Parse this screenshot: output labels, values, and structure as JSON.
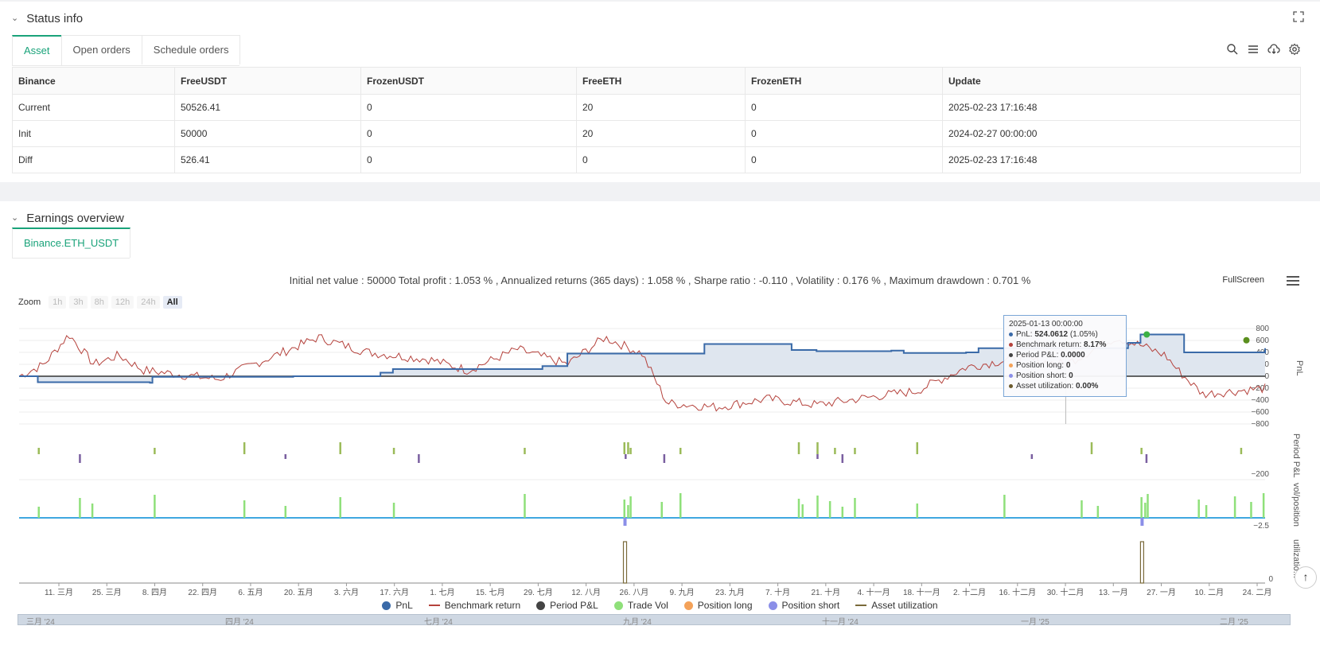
{
  "status": {
    "title": "Status info",
    "tabs": [
      "Asset",
      "Open orders",
      "Schedule orders"
    ],
    "active_tab": "Asset",
    "columns": [
      "Binance",
      "FreeUSDT",
      "FrozenUSDT",
      "FreeETH",
      "FrozenETH",
      "Update"
    ],
    "rows": [
      {
        "label": "Current",
        "cells": [
          "50526.41",
          "0",
          "20",
          "0",
          "2025-02-23 17:16:48"
        ]
      },
      {
        "label": "Init",
        "cells": [
          "50000",
          "0",
          "20",
          "0",
          "2024-02-27 00:00:00"
        ]
      },
      {
        "label": "Diff",
        "cells": [
          "526.41",
          "0",
          "0",
          "0",
          "2025-02-23 17:16:48"
        ]
      }
    ]
  },
  "earnings": {
    "title": "Earnings overview",
    "tab": "Binance.ETH_USDT",
    "summary": "Initial net value : 50000 Total profit : 1.053 % , Annualized returns (365 days) : 1.058 % , Sharpe ratio : -0.110 , Volatility : 0.176 % , Maximum drawdown : 0.701 %",
    "fullscreen_label": "FullScreen",
    "zoom_label": "Zoom",
    "zoom_buttons": [
      "1h",
      "3h",
      "8h",
      "12h",
      "24h",
      "All"
    ],
    "zoom_active": "All"
  },
  "tooltip": {
    "date": "2025-01-13 00:00:00",
    "rows": [
      {
        "label": "PnL: ",
        "value": "524.0612",
        "extra": " (1.05%)",
        "color": "#3a6aa8"
      },
      {
        "label": "Benchmark return: ",
        "value": "8.17%",
        "extra": "",
        "color": "#b5423c"
      },
      {
        "label": "Period P&L: ",
        "value": "0.0000",
        "extra": "",
        "color": "#444444"
      },
      {
        "label": "Position long: ",
        "value": "0",
        "extra": "",
        "color": "#f4a259"
      },
      {
        "label": "Position short: ",
        "value": "0",
        "extra": "",
        "color": "#8b8fe8"
      },
      {
        "label": "Asset utilization: ",
        "value": "0.00%",
        "extra": "",
        "color": "#6b5a2e"
      }
    ]
  },
  "legend": [
    {
      "label": "PnL",
      "color": "#3a6aa8",
      "kind": "dot"
    },
    {
      "label": "Benchmark return",
      "color": "#b5423c",
      "kind": "line"
    },
    {
      "label": "Period P&L",
      "color": "#444444",
      "kind": "dot"
    },
    {
      "label": "Trade Vol",
      "color": "#8fe07a",
      "kind": "dot"
    },
    {
      "label": "Position long",
      "color": "#f4a259",
      "kind": "dot"
    },
    {
      "label": "Position short",
      "color": "#8b8fe8",
      "kind": "dot"
    },
    {
      "label": "Asset utilization",
      "color": "#7a6a3a",
      "kind": "line"
    }
  ],
  "scroller_labels": [
    "三月 '24",
    "四月 '24",
    "七月 '24",
    "九月 '24",
    "十一月 '24",
    "一月 '25",
    "二月 '25"
  ],
  "chart_data": {
    "type": "line",
    "x_ticks": [
      "11. 三月",
      "25. 三月",
      "8. 四月",
      "22. 四月",
      "6. 五月",
      "20. 五月",
      "3. 六月",
      "17. 六月",
      "1. 七月",
      "15. 七月",
      "29. 七月",
      "12. 八月",
      "26. 八月",
      "9. 九月",
      "23. 九月",
      "7. 十月",
      "21. 十月",
      "4. 十一月",
      "18. 十一月",
      "2. 十二月",
      "16. 十二月",
      "30. 十二月",
      "13. 一月",
      "27. 一月",
      "10. 二月",
      "24. 二月"
    ],
    "panes": [
      {
        "name": "PnL",
        "ylabel": "PnL",
        "y_ticks": [
          "800",
          "600",
          "400",
          "200",
          "0",
          "−200",
          "−400",
          "−600",
          "−800"
        ]
      },
      {
        "name": "Period P&L",
        "ylabel": "Period P&L",
        "y_ticks": [
          "−200"
        ]
      },
      {
        "name": "vol/position",
        "ylabel": "vol/position",
        "y_ticks": [
          "−2.5"
        ]
      },
      {
        "name": "utilization",
        "ylabel": "utilizatio...",
        "y_ticks": [
          "0"
        ]
      }
    ],
    "pnl": {
      "x": [
        0,
        0.015,
        0.105,
        0.107,
        0.22,
        0.29,
        0.3,
        0.42,
        0.44,
        0.49,
        0.5,
        0.54,
        0.55,
        0.6,
        0.62,
        0.64,
        0.7,
        0.71,
        0.76,
        0.77,
        0.8,
        0.88,
        0.89,
        0.9,
        0.905,
        0.925,
        0.935,
        0.96,
        1.0
      ],
      "y": [
        0,
        -100,
        -110,
        -10,
        0,
        60,
        120,
        170,
        380,
        380,
        380,
        380,
        540,
        540,
        440,
        420,
        430,
        390,
        400,
        470,
        470,
        470,
        560,
        700,
        700,
        700,
        400,
        400,
        470
      ]
    },
    "benchmark_keypoints": {
      "x": [
        0,
        0.02,
        0.04,
        0.06,
        0.08,
        0.1,
        0.12,
        0.16,
        0.2,
        0.24,
        0.28,
        0.33,
        0.36,
        0.4,
        0.44,
        0.47,
        0.5,
        0.52,
        0.56,
        0.6,
        0.64,
        0.7,
        0.72,
        0.76,
        0.8,
        0.84,
        0.88,
        0.9,
        0.92,
        0.93,
        0.95,
        1.0
      ],
      "y": [
        0,
        200,
        700,
        200,
        350,
        100,
        50,
        -50,
        300,
        650,
        400,
        280,
        100,
        450,
        200,
        650,
        380,
        -450,
        -520,
        -380,
        -480,
        -300,
        -250,
        150,
        300,
        200,
        650,
        520,
        350,
        100,
        -300,
        -200
      ]
    },
    "period_pnl_bars": [
      0.015,
      0.048,
      0.108,
      0.18,
      0.213,
      0.257,
      0.3,
      0.32,
      0.405,
      0.485,
      0.486,
      0.488,
      0.49,
      0.517,
      0.53,
      0.625,
      0.64,
      0.64,
      0.654,
      0.66,
      0.67,
      0.72,
      0.812,
      0.86,
      0.9,
      0.904,
      0.98
    ],
    "trade_vol_bars": [
      0.015,
      0.048,
      0.058,
      0.108,
      0.18,
      0.213,
      0.257,
      0.3,
      0.405,
      0.485,
      0.488,
      0.49,
      0.515,
      0.53,
      0.625,
      0.628,
      0.64,
      0.65,
      0.66,
      0.67,
      0.72,
      0.79,
      0.852,
      0.865,
      0.9,
      0.903,
      0.905,
      0.946,
      0.952,
      0.975,
      0.988,
      0.998
    ],
    "utilization_spikes": [
      {
        "x": 0.485,
        "value": 1
      },
      {
        "x": 0.9,
        "value": 1
      }
    ]
  }
}
